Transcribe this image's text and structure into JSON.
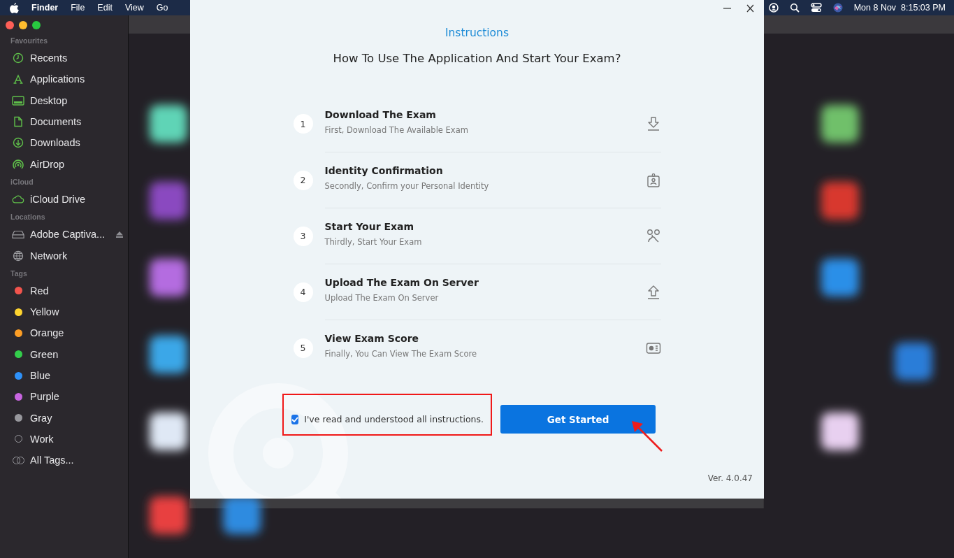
{
  "menu_bar": {
    "app_name": "Finder",
    "menus": [
      "File",
      "Edit",
      "View",
      "Go"
    ],
    "clock": "Mon 8 Nov  8:15:03 PM"
  },
  "sidebar": {
    "sections": [
      {
        "header": "Favourites",
        "items": [
          {
            "label": "Recents"
          },
          {
            "label": "Applications"
          },
          {
            "label": "Desktop"
          },
          {
            "label": "Documents"
          },
          {
            "label": "Downloads"
          },
          {
            "label": "AirDrop"
          }
        ]
      },
      {
        "header": "iCloud",
        "items": [
          {
            "label": "iCloud Drive"
          }
        ]
      },
      {
        "header": "Locations",
        "items": [
          {
            "label": "Adobe Captiva...",
            "ejectable": true
          },
          {
            "label": "Network",
            "ejectable": false
          }
        ]
      },
      {
        "header": "Tags",
        "tags": [
          {
            "label": "Red",
            "kind": "tag",
            "color": "#f2544d"
          },
          {
            "label": "Yellow",
            "kind": "tag",
            "color": "#fed42f"
          },
          {
            "label": "Orange",
            "kind": "tag",
            "color": "#fc9e25"
          },
          {
            "label": "Green",
            "kind": "tag",
            "color": "#33cd4b"
          },
          {
            "label": "Blue",
            "kind": "tag",
            "color": "#2e91f9"
          },
          {
            "label": "Purple",
            "kind": "tag",
            "color": "#c865e0"
          },
          {
            "label": "Gray",
            "kind": "tag",
            "color": "#98989d"
          },
          {
            "label": "Work",
            "kind": "hollow"
          },
          {
            "label": "All Tags...",
            "kind": "all"
          }
        ]
      }
    ]
  },
  "dialog": {
    "title": "Instructions",
    "heading": "How To Use The Application And Start Your Exam?",
    "steps": [
      {
        "number": "1",
        "title": "Download The Exam",
        "subtitle": "First, Download The Available Exam"
      },
      {
        "number": "2",
        "title": "Identity Confirmation",
        "subtitle": "Secondly, Confirm your Personal Identity"
      },
      {
        "number": "3",
        "title": "Start Your Exam",
        "subtitle": "Thirdly, Start Your Exam"
      },
      {
        "number": "4",
        "title": "Upload The Exam On Server",
        "subtitle": "Upload The Exam On Server"
      },
      {
        "number": "5",
        "title": "View Exam Score",
        "subtitle": "Finally, You Can View The Exam Score"
      }
    ],
    "agreement": {
      "label": "I've read and understood all instructions.",
      "checked": true
    },
    "button": "Get Started",
    "version": "Ver. 4.0.47"
  }
}
